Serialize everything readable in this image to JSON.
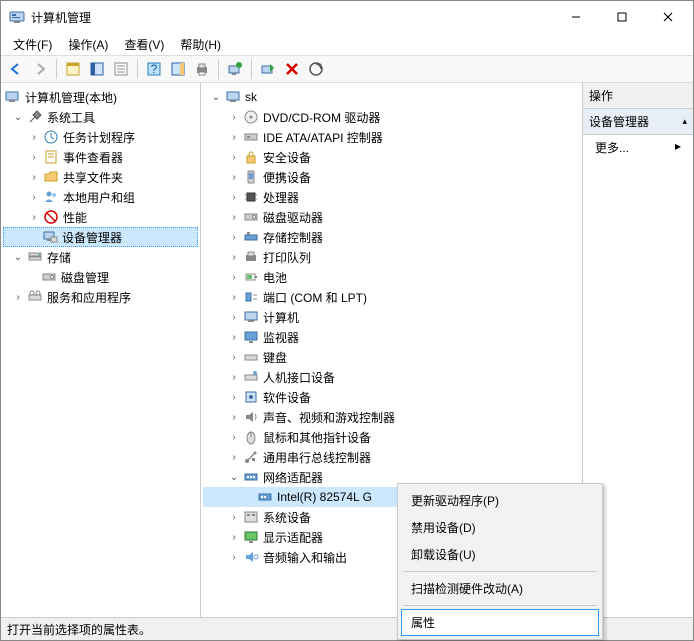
{
  "window": {
    "title": "计算机管理",
    "min_tooltip": "最小化",
    "max_tooltip": "最大化",
    "close_tooltip": "关闭"
  },
  "menubar": {
    "file": "文件(F)",
    "action": "操作(A)",
    "view": "查看(V)",
    "help": "帮助(H)"
  },
  "left_tree": {
    "root": "计算机管理(本地)",
    "system_tools": "系统工具",
    "task_scheduler": "任务计划程序",
    "event_viewer": "事件查看器",
    "shared_folders": "共享文件夹",
    "local_users": "本地用户和组",
    "performance": "性能",
    "device_manager": "设备管理器",
    "storage": "存储",
    "disk_management": "磁盘管理",
    "services_apps": "服务和应用程序"
  },
  "device_tree": {
    "root": "sk",
    "dvd": "DVD/CD-ROM 驱动器",
    "ide": "IDE ATA/ATAPI 控制器",
    "security": "安全设备",
    "portable": "便携设备",
    "processors": "处理器",
    "disk_drives": "磁盘驱动器",
    "storage_ctrl": "存储控制器",
    "print_queues": "打印队列",
    "batteries": "电池",
    "ports": "端口 (COM 和 LPT)",
    "computer": "计算机",
    "monitors": "监视器",
    "keyboards": "键盘",
    "hid": "人机接口设备",
    "software_dev": "软件设备",
    "sound": "声音、视频和游戏控制器",
    "mouse": "鼠标和其他指针设备",
    "usb": "通用串行总线控制器",
    "network": "网络适配器",
    "network_item": "Intel(R) 82574L G",
    "system_devices": "系统设备",
    "display": "显示适配器",
    "audio_io": "音频输入和输出"
  },
  "context_menu": {
    "update_driver": "更新驱动程序(P)",
    "disable_device": "禁用设备(D)",
    "uninstall_device": "卸载设备(U)",
    "scan_hardware": "扫描检测硬件改动(A)",
    "properties": "属性"
  },
  "actions_pane": {
    "header": "操作",
    "section": "设备管理器",
    "more": "更多..."
  },
  "statusbar": {
    "text": "打开当前选择项的属性表。"
  }
}
